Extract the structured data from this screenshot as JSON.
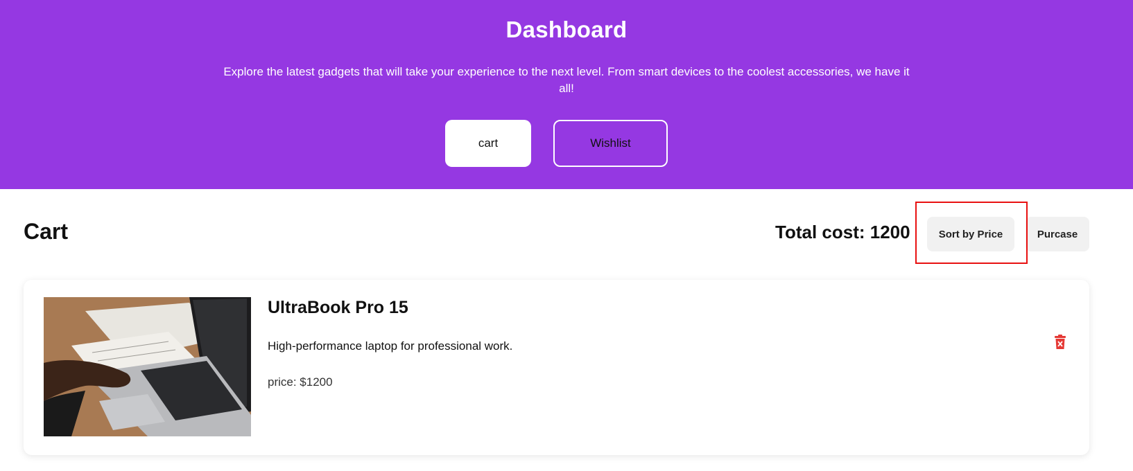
{
  "hero": {
    "title": "Dashboard",
    "subtitle": "Explore the latest gadgets that will take your experience to the next level. From smart devices to the coolest accessories, we have it all!",
    "cart_label": "cart",
    "wishlist_label": "Wishlist"
  },
  "cart": {
    "title": "Cart",
    "total_label": "Total cost: 1200",
    "sort_label": "Sort by Price",
    "purchase_label": "Purcase",
    "items": [
      {
        "name": "UltraBook Pro 15",
        "description": "High-performance laptop for professional work.",
        "price": "price: $1200"
      }
    ]
  },
  "colors": {
    "brand": "#9538e2",
    "highlight": "#e81010",
    "delete": "#e53935"
  },
  "icons": {
    "delete": "trash-icon"
  }
}
